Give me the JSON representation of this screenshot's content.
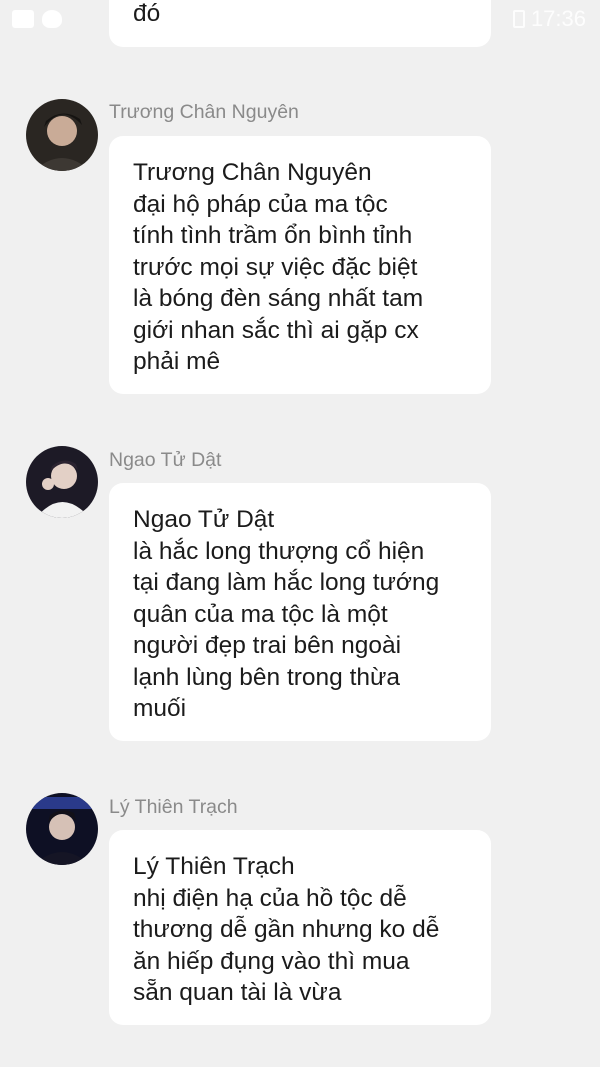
{
  "status_bar": {
    "time": "17:36",
    "left_icons": [
      "mail-icon",
      "bird-icon"
    ]
  },
  "messages": [
    {
      "sender": "",
      "lines": [
        "đó"
      ]
    },
    {
      "sender": "Trương Chân Nguyên",
      "lines": [
        "Trương Chân Nguyên",
        "đại hộ pháp của ma tộc",
        "tính tình trầm ổn bình tỉnh",
        "trước mọi sự việc đặc biệt",
        "là bóng đèn sáng nhất tam",
        "giới nhan sắc thì ai gặp cx",
        "phải mê"
      ]
    },
    {
      "sender": "Ngao Tử Dật",
      "lines": [
        "Ngao Tử Dật",
        "là hắc long thượng cổ hiện",
        "tại đang làm hắc long tướng",
        "quân của ma tộc là một",
        "người đẹp trai bên ngoài",
        "lạnh lùng bên trong thừa",
        "muối"
      ]
    },
    {
      "sender": "Lý Thiên Trạch",
      "lines": [
        "Lý Thiên Trạch",
        "nhị điện hạ của hồ tộc dễ",
        "thương dễ gần nhưng ko dễ",
        "ăn hiếp đụng vào thì mua",
        "sẵn quan tài là vừa"
      ]
    }
  ],
  "colors": {
    "background": "#f0f0f0",
    "bubble": "#ffffff",
    "sender_name": "#8a8a8a",
    "text": "#1b1b1b"
  }
}
